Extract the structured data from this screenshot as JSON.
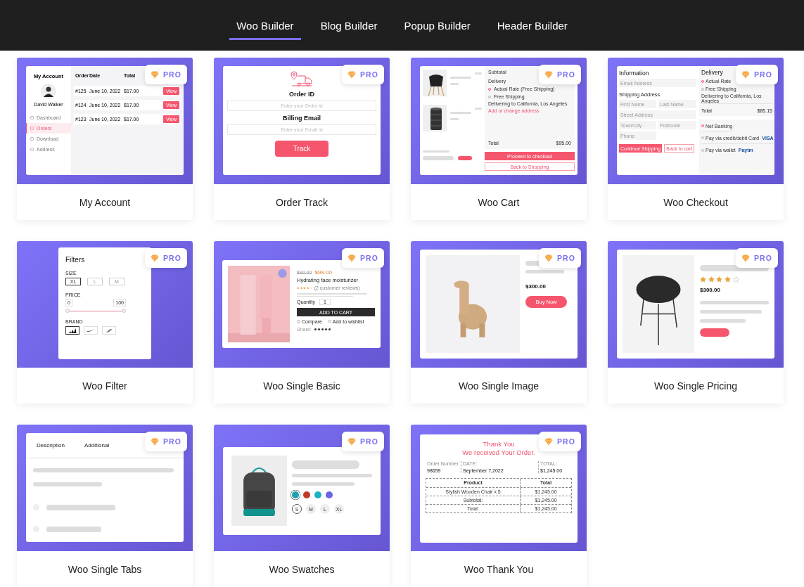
{
  "tabs": [
    {
      "label": "Woo Builder",
      "selected": true
    },
    {
      "label": "Blog Builder",
      "selected": false
    },
    {
      "label": "Popup Builder",
      "selected": false
    },
    {
      "label": "Header Builder",
      "selected": false
    }
  ],
  "templates": [
    {
      "name": "My Account",
      "badge": "PRO",
      "preview": {
        "kind": "account",
        "title": "My Account",
        "user": "David Walker",
        "menu": [
          {
            "label": "Dashboard",
            "selected": false
          },
          {
            "label": "Orders",
            "selected": true
          },
          {
            "label": "Download",
            "selected": false
          },
          {
            "label": "Address",
            "selected": false
          }
        ],
        "columns": [
          "Order",
          "Date",
          "Total"
        ],
        "rows": [
          {
            "order": "#125",
            "date": "June 10, 2022",
            "total": "$17.00",
            "action": "View"
          },
          {
            "order": "#124",
            "date": "June 10, 2022",
            "total": "$17.00",
            "action": "View"
          },
          {
            "order": "#123",
            "date": "June 10, 2022",
            "total": "$17.00",
            "action": "View"
          }
        ]
      }
    },
    {
      "name": "Order Track",
      "badge": "PRO",
      "preview": {
        "kind": "track",
        "fields": [
          {
            "label": "Order ID",
            "placeholder": "Enter your Order id"
          },
          {
            "label": "Billing Email",
            "placeholder": "Enter your Email id"
          }
        ],
        "button": "Track"
      }
    },
    {
      "name": "Woo Cart",
      "badge": "PRO",
      "preview": {
        "kind": "cart",
        "subtotal_label": "Subtotal",
        "delivery_label": "Delivery",
        "options": [
          {
            "label": "Actual Rate (Free Shipping)",
            "selected": true
          },
          {
            "label": "Free Shipping",
            "selected": false
          }
        ],
        "address": "Delivering to California, Los Angeles",
        "address_link": "Add or change address",
        "total_label": "Total",
        "total": "$95.00",
        "buttons": [
          "Proceed to checkout",
          "Back to Shopping"
        ]
      }
    },
    {
      "name": "Woo Checkout",
      "badge": "PRO",
      "preview": {
        "kind": "checkout",
        "info_title": "Information",
        "email_placeholder": "Email Address",
        "shipping_title": "Shipping Address",
        "fields": [
          {
            "placeholder": "First Name",
            "wide": false
          },
          {
            "placeholder": "Last Name",
            "wide": false
          },
          {
            "placeholder": "Street Address",
            "wide": true
          },
          {
            "placeholder": "Town/City",
            "wide": false
          },
          {
            "placeholder": "Postcode",
            "wide": false
          },
          {
            "placeholder": "Phone",
            "wide": false
          }
        ],
        "buttons": [
          "Continue Shipping",
          "Back to cart"
        ],
        "delivery_title": "Delivery",
        "options": [
          {
            "label": "Actual Rate",
            "selected": true
          },
          {
            "label": "Free Shipping",
            "selected": false
          }
        ],
        "address": "Delivering to California, Los Angeles",
        "total_label": "Total",
        "total": "$85.15",
        "payments": [
          {
            "label": "Net Banking",
            "selected": true
          },
          {
            "label": "Pay via credit/debit Card",
            "logo": "VISA",
            "selected": false
          },
          {
            "label": "Pay via wallet",
            "logo": "Paytm",
            "selected": false
          }
        ]
      }
    },
    {
      "name": "Woo Filter",
      "badge": "PRO",
      "preview": {
        "kind": "filter",
        "title": "Filters",
        "size_label": "SIZE",
        "sizes": [
          {
            "label": "XL",
            "selected": true
          },
          {
            "label": "L",
            "selected": false
          },
          {
            "label": "M",
            "selected": false
          }
        ],
        "price_label": "PRICE",
        "price_range": {
          "min": "0",
          "max": "100",
          "level": 1
        },
        "brand_label": "BRAND",
        "brands": [
          {
            "selected": true
          },
          {
            "selected": false
          },
          {
            "selected": false
          }
        ]
      }
    },
    {
      "name": "Woo Single Basic",
      "badge": "PRO",
      "preview": {
        "kind": "single_basic",
        "old_price": "$90.00",
        "price": "$98.00",
        "title": "Hydrating face moisturizer",
        "stars": 4,
        "reviews": "(2 customer reviews)",
        "quantity_label": "Quantity",
        "quantity": "1",
        "button": "ADD TO CART",
        "compare": "Compare",
        "wishlist": "Add to wishlist",
        "share_label": "Share:"
      }
    },
    {
      "name": "Woo Single Image",
      "badge": "PRO",
      "preview": {
        "kind": "single_image",
        "price": "$300.00",
        "button": "Buy Now"
      }
    },
    {
      "name": "Woo Single Pricing",
      "badge": "PRO",
      "preview": {
        "kind": "single_pricing",
        "stars": 4,
        "price": "$300.00"
      }
    },
    {
      "name": "Woo Single Tabs",
      "badge": "PRO",
      "preview": {
        "kind": "tabs",
        "tabs": [
          "Description",
          "Additional"
        ]
      }
    },
    {
      "name": "Woo Swatches",
      "badge": "PRO",
      "preview": {
        "kind": "swatches",
        "colors": [
          {
            "color": "#1aa3b3",
            "selected": true
          },
          {
            "color": "#c0392b",
            "selected": false
          },
          {
            "color": "#1ab3c4",
            "selected": false
          },
          {
            "color": "#6a63e6",
            "selected": false
          }
        ],
        "sizes": [
          {
            "label": "S",
            "selected": true
          },
          {
            "label": "M",
            "selected": false
          },
          {
            "label": "L",
            "selected": false
          },
          {
            "label": "XL",
            "selected": false
          }
        ]
      }
    },
    {
      "name": "Woo Thank You",
      "badge": "PRO",
      "preview": {
        "kind": "thankyou",
        "title": "Thank You",
        "subtitle": "We received Your Order.",
        "meta": [
          {
            "label": "Order Number",
            "value": "98659"
          },
          {
            "label": "DATE:",
            "value": "September 7,2022"
          },
          {
            "label": "TOTAL:",
            "value": "$1,245.00"
          }
        ],
        "columns": [
          "Product",
          "Total"
        ],
        "rows": [
          [
            "Stylish Wooden Chair x 5",
            "$1,245.00"
          ],
          [
            "Subtotal:",
            "$1,245.00"
          ],
          [
            "Total:",
            "$1,245.00"
          ]
        ]
      }
    }
  ]
}
